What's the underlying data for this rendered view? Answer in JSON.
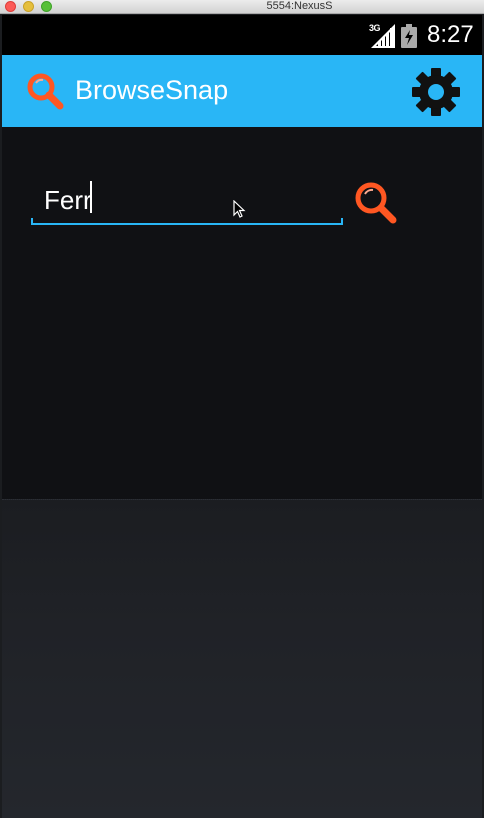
{
  "window": {
    "title": "5554:NexusS"
  },
  "status_bar": {
    "network": "3G",
    "time": "8:27"
  },
  "action_bar": {
    "title": "BrowseSnap",
    "app_icon": "search-icon",
    "settings_icon": "gear-icon"
  },
  "search": {
    "value": "Ferr",
    "button_icon": "search-icon"
  },
  "colors": {
    "accent": "#29b6f6",
    "icon_orange": "#ff5722",
    "background": "#101114"
  }
}
